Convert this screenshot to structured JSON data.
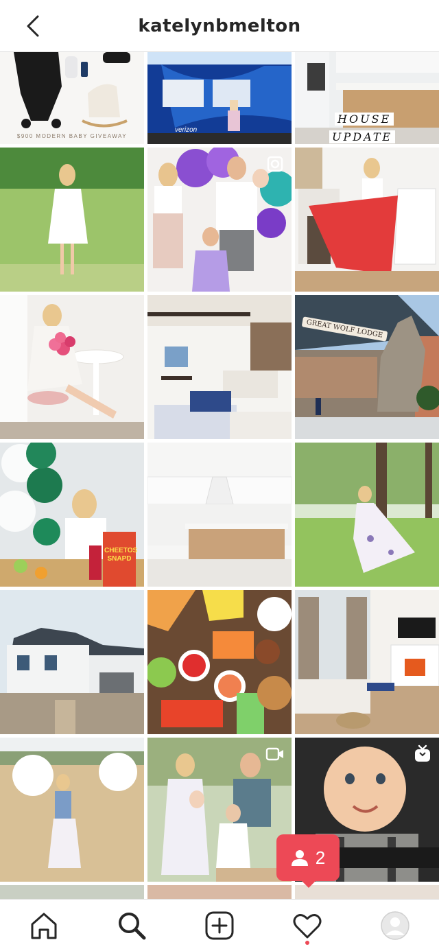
{
  "header": {
    "title": "katelynbmelton",
    "back_icon": "chevron-left-icon"
  },
  "grid": {
    "posts": [
      {
        "name": "post-baby-giveaway",
        "text": "$900 MODERN BABY GIVEAWAY"
      },
      {
        "name": "post-verizon-truck",
        "text": "verizon"
      },
      {
        "name": "post-house-update",
        "caption_line1": "HOUSE",
        "caption_line2": "UPDATE"
      },
      {
        "name": "post-white-dress-field"
      },
      {
        "name": "post-family-balloons",
        "badge": "carousel-icon"
      },
      {
        "name": "post-red-skirt-fireplace"
      },
      {
        "name": "post-pink-roses-chair"
      },
      {
        "name": "post-living-room-balcony"
      },
      {
        "name": "post-great-wolf-lodge",
        "sign": "GREAT WOLF LODGE"
      },
      {
        "name": "post-green-balloons-snacks",
        "snack_label": "CHEETOS SNAPD"
      },
      {
        "name": "post-white-kitchen"
      },
      {
        "name": "post-floral-dress-park"
      },
      {
        "name": "post-new-house-exterior"
      },
      {
        "name": "post-veggie-platter",
        "badge": "carousel-icon"
      },
      {
        "name": "post-living-room-fireplace"
      },
      {
        "name": "post-white-balloons-field"
      },
      {
        "name": "post-family-portrait",
        "badge": "video-icon"
      },
      {
        "name": "post-baby-car-seat",
        "badge": "igtv-icon"
      }
    ]
  },
  "notification": {
    "count": "2",
    "icon": "user-icon",
    "color": "#ed4956"
  },
  "tabbar": {
    "items": [
      {
        "name": "home-icon"
      },
      {
        "name": "search-icon"
      },
      {
        "name": "new-post-icon"
      },
      {
        "name": "activity-heart-icon"
      },
      {
        "name": "profile-avatar-icon"
      }
    ]
  }
}
